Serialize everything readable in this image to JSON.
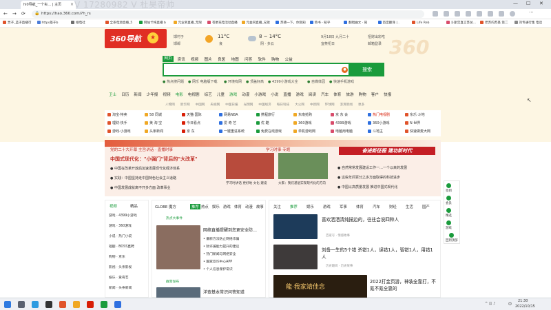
{
  "browser": {
    "tab_title": "hi0导航_一个实…  | 主页",
    "watermark": "V 17280982 V 杜昊帝帅",
    "url": "https://hao.360.com/?h_rs",
    "min_icon": "—",
    "max_icon": "☐",
    "close_icon": "✕"
  },
  "bookmarks": [
    {
      "label": "贾子_蓝子直播可以…",
      "color": "#e0532a"
    },
    {
      "label": "https基于bili捷",
      "color": "#4c7cd8"
    },
    {
      "label": "继电社",
      "color": "#6d6d6d"
    },
    {
      "label": "全系电源直播_5k…",
      "color": "#e0532a"
    },
    {
      "label": "网站卡纯直播 bl…",
      "color": "#1a9b3c"
    },
    {
      "label": "元业到直播_无限乙…",
      "color": "#f0a824"
    },
    {
      "label": "苍爵充电活动直播_5k…",
      "color": "#d84c6b"
    },
    {
      "label": "元益同直播_兄弟们…",
      "color": "#f0a824"
    },
    {
      "label": "苏德一下，你就知道",
      "color": "#2e6fe0"
    },
    {
      "label": "简书 - 知乎",
      "color": "#2e6fe0"
    },
    {
      "label": "翻唱曲文 · 知乎",
      "color": "#2e6fe0"
    },
    {
      "label": "百度翻译 | ...",
      "color": "#2e6fe0"
    },
    {
      "label": "Life Reborn",
      "color": "#e0532a"
    },
    {
      "label": "斗斯宫直言苏总…",
      "color": "#d84c6b"
    },
    {
      "label": "老苏的苏基 第二集…",
      "color": "#e0532a"
    },
    {
      "label": "刘专通行集 电话起…",
      "color": "#888888"
    }
  ],
  "header": {
    "logo": "360导航",
    "location": "邯村子",
    "location2": "邯郸",
    "temp1": "11°C",
    "air": "良",
    "temp2": "8 ~ 14°C",
    "weather_sub": "阴 · 多云",
    "date": "9月18日 九月二十",
    "date_sub": "宜祭祀日",
    "extra1": "招财出彩吃",
    "extra2": "邮箱登录",
    "deco": "360"
  },
  "search": {
    "tabs": [
      "网页",
      "资讯",
      "视频",
      "图片",
      "良医",
      "地图",
      "问答",
      "软件",
      "购物",
      "公益"
    ],
    "active_tab": "网页",
    "button": "搜索",
    "cam": "●"
  },
  "hot_links": [
    "热点搜问题",
    "网乐 电脑版下载",
    "环境有网",
    "顶盖好高",
    "4399小游戏大全",
    "自媒体园",
    "快速手机游戏"
  ],
  "nav_row": [
    "卫士",
    "日历",
    "新闻",
    "少年报",
    "视频",
    "电影",
    "电视剧",
    "综艺",
    "儿童",
    "游戏",
    "动漫",
    "小游戏",
    "小说",
    "直播",
    "游戏",
    "阅读",
    "汽车",
    "体育",
    "旅游",
    "购物",
    "客户",
    "快报"
  ],
  "sub_row": [
    "人物网",
    "新华网",
    "中国网",
    "央视网",
    "中国日报",
    "光明网",
    "中国经济",
    "每日科技",
    "大公网",
    "中新网",
    "环球网",
    "澎湃新闻",
    "更多"
  ],
  "sites": [
    [
      "淘宝·特卖",
      "58 同城",
      "天猫·国际",
      "网易NBA",
      "携程旅行",
      "东南抢购",
      "京 东 会",
      "热门电视剧",
      "东乐·斗地"
    ],
    [
      "理财·快手",
      "美 淘 宝",
      "今日看点",
      "爱 奇 艺",
      "优 酷",
      "360游戏",
      "4399游戏",
      "360小游戏",
      "N 世界"
    ],
    [
      "游戏·小游戏",
      "头条新闻",
      "京 东",
      "一键重进系统",
      "免费在线游戏",
      "单机游戏网",
      "电脑用电脑",
      "斗地主",
      "快速做麦大网"
    ]
  ],
  "site_colors": [
    "#e0532a",
    "#f0a824",
    "#d81e06",
    "#2e6fe0",
    "#1a9b3c",
    "#f0a824",
    "#d84c6b",
    "#2e6fe0",
    "#e0532a"
  ],
  "banner": {
    "headline": "党的二十大开幕 主旨讲话 · 直播时事",
    "tag": "学习时事·专题",
    "big": "中国式现代化：\"小强门\"背后的\"大改革\"",
    "list": [
      "● 中国在改革开放后加速发展现代化经济体系",
      "● 实践：中国坚持走中国特色社会主义道路",
      "● 中国发展成就离不开多方面 改革事业"
    ],
    "cap1": "学习时讲话 更好地 文化 建设",
    "cap2": "大家：我们基层实现现代化的方向",
    "slogan": "奋进新征程 建功新时代",
    "right_list": [
      "● 自然常常发展建设工作一…一个以来的发展",
      "● 这些年间百分之多方面取得的科技进步",
      "● 中国以高质量发展 推进中国式现代化"
    ]
  },
  "col_left": {
    "tabs": [
      "视频",
      "精品"
    ],
    "items": [
      "游戏 · 4399小游戏",
      "游戏 · 360游戏",
      "小说 · 热门小说",
      "短剧 · BOSS直聘",
      "购物 · 京东",
      "影视 · 头条影视",
      "娱乐 · 爱奇艺",
      "新闻 · 头条新闻"
    ]
  },
  "col_mid": {
    "tabs": [
      "推荐",
      "热点",
      "娱乐",
      "游戏",
      "体育",
      "动漫",
      "故事"
    ],
    "active": "推荐",
    "section": "热点大事件",
    "headline1": "网络直播提醒到您更安全防…",
    "sub1": "• 最新方法防止网络诈骗",
    "items": [
      "• 防诈骗能力提升的建议",
      "• 热门新闻与网络安全",
      "• 国家反诈中心APP",
      "• 个人信息保护常识"
    ],
    "headline2": "洋查基本常识问答知道"
  },
  "col_right": {
    "tabs": [
      "关注",
      "推荐",
      "娱乐",
      "游戏",
      "军事",
      "体育",
      "汽车",
      "财经",
      "生活",
      "国产"
    ],
    "active": "推荐",
    "news1": "喜欢洒洒清纯描边的，往往会说四种人",
    "src1": "百家号 · 情感故事",
    "news2": "刘备一生的5个错 杀错1人，误错1人，智错1人，用错1人",
    "src2": "历史趣闻 · 历史故事",
    "news3": "2022打金页游，神装全靠打，不氪不氪全靠的",
    "ad_text": "龍·我家靖佳念"
  },
  "floatbar": [
    "签到",
    "会员",
    "精选",
    "游戏",
    "回到顶部"
  ],
  "taskbar": {
    "time": "21:30",
    "date": "2022/10/15",
    "lang": "中",
    "tray": "^ ◫ ♪"
  }
}
